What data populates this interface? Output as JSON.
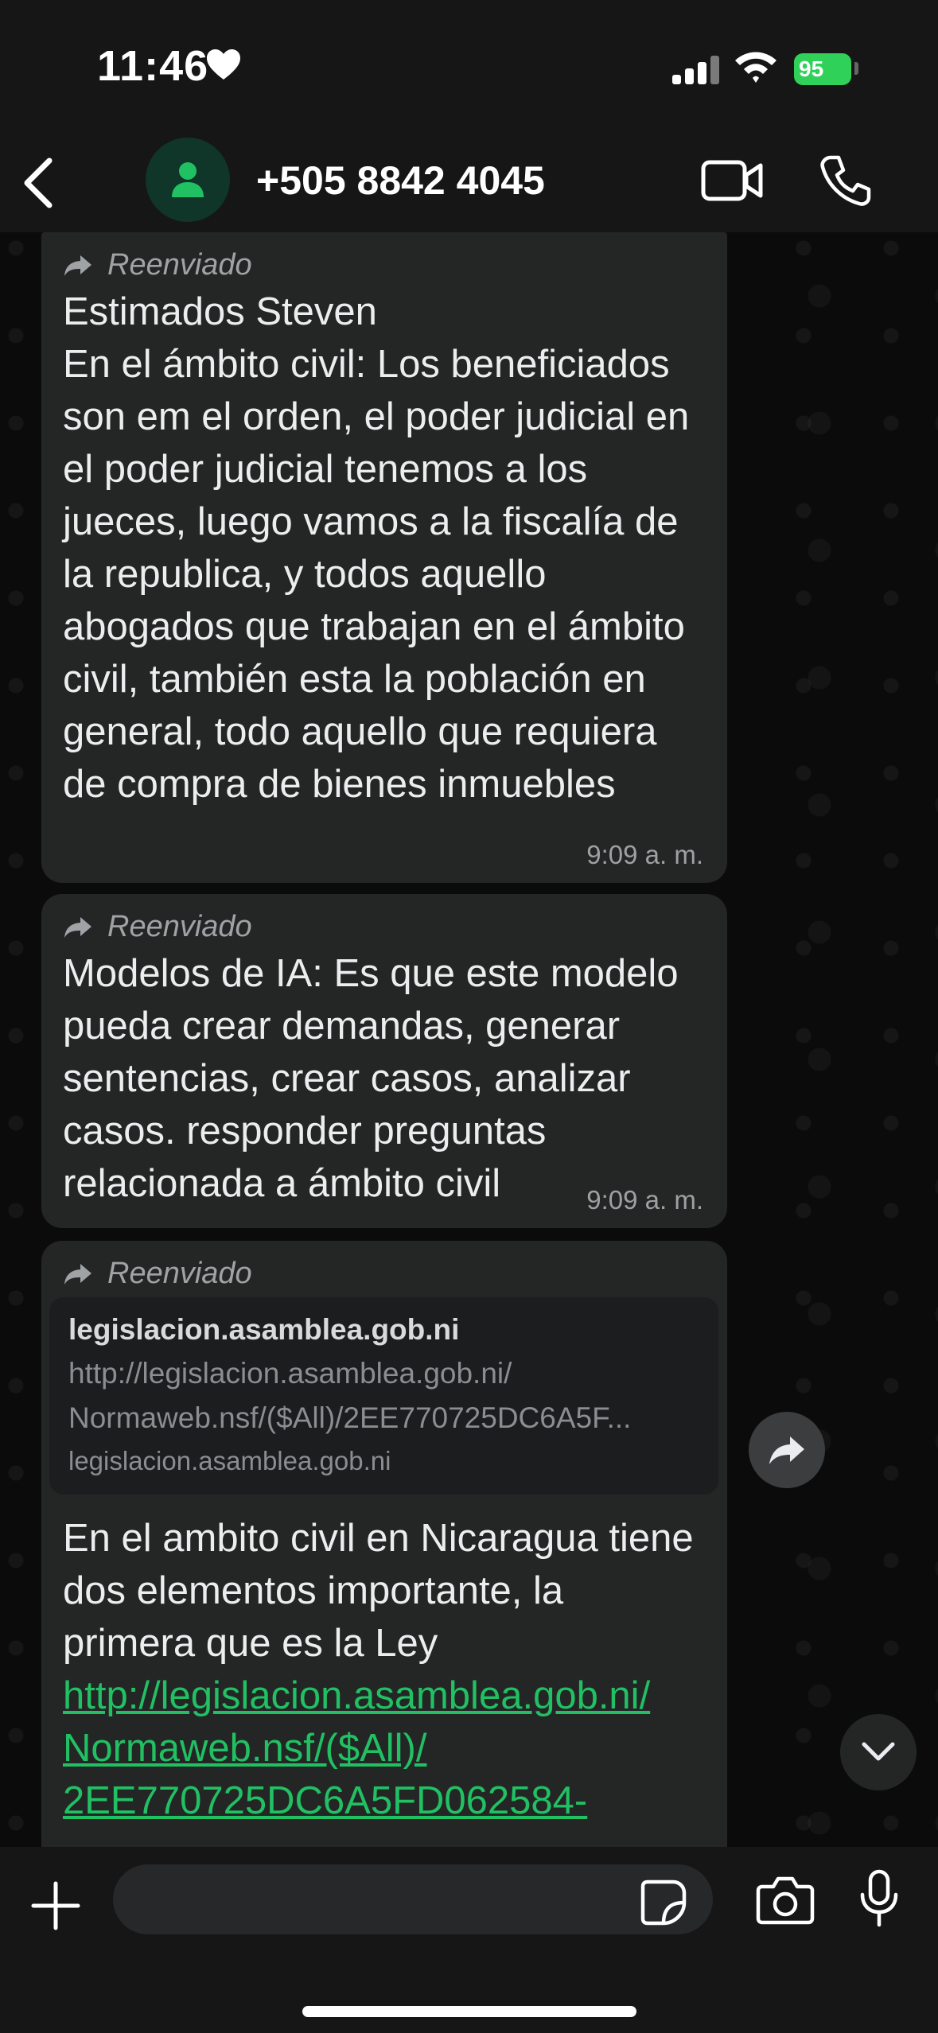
{
  "status_bar": {
    "time": "11:46",
    "battery": "95"
  },
  "header": {
    "contact": "+505 8842 4045"
  },
  "messages": [
    {
      "forwarded_label": "Reenviado",
      "text": "Estimados Steven\nEn el ámbito civil: Los beneficiados son em el orden, el poder judicial en el poder judicial tenemos a los jueces, luego vamos a la fiscalía de la republica, y todos aquello abogados que trabajan en el ámbito civil, también esta la población en general, todo aquello que requiera de compra de bienes inmuebles",
      "time": "9:09 a. m."
    },
    {
      "forwarded_label": "Reenviado",
      "text": "Modelos de IA: Es que este modelo pueda crear demandas, generar sentencias, crear casos, analizar casos. responder preguntas relacionada a ámbito civil",
      "time": "9:09 a. m."
    },
    {
      "forwarded_label": "Reenviado",
      "link_preview": {
        "title": "legislacion.asamblea.gob.ni",
        "url": "http://legislacion.asamblea.gob.ni/\nNormaweb.nsf/($All)/2EE770725DC6A5F...",
        "domain": "legislacion.asamblea.gob.ni"
      },
      "text": "En el ambito civil en Nicaragua tiene dos elementos importante, la primera que es la Ley",
      "link": "http://legislacion.asamblea.gob.ni/\nNormaweb.nsf/($All)/\n2EE770725DC6A5FD062584-"
    }
  ],
  "colors": {
    "accent": "#21c063",
    "bubble": "#242626",
    "header": "#161616"
  }
}
